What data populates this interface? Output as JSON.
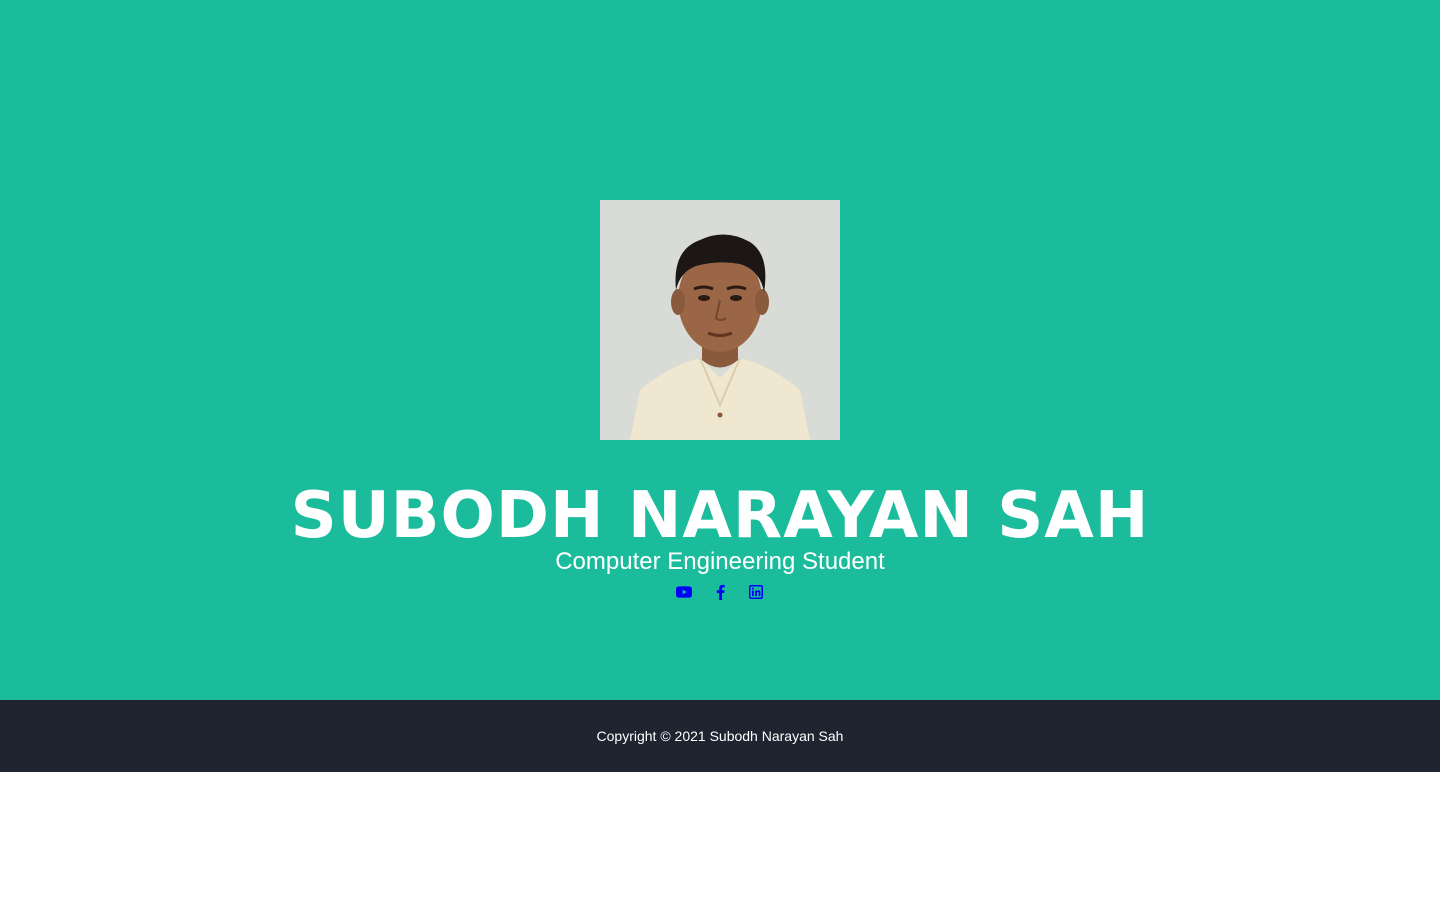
{
  "masthead": {
    "background_color": "#1abc9c",
    "avatar_alt": "profile photo",
    "name": "SUBODH NARAYAN SAH",
    "subtitle": "Computer Engineering Student",
    "social_links": [
      {
        "icon": "youtube-icon",
        "color": "#0000ff"
      },
      {
        "icon": "facebook-icon",
        "color": "#0000ff"
      },
      {
        "icon": "linkedin-icon",
        "color": "#0000ff"
      }
    ]
  },
  "footer": {
    "background_color": "#1e2430",
    "copyright": "Copyright © 2021 Subodh Narayan Sah"
  }
}
